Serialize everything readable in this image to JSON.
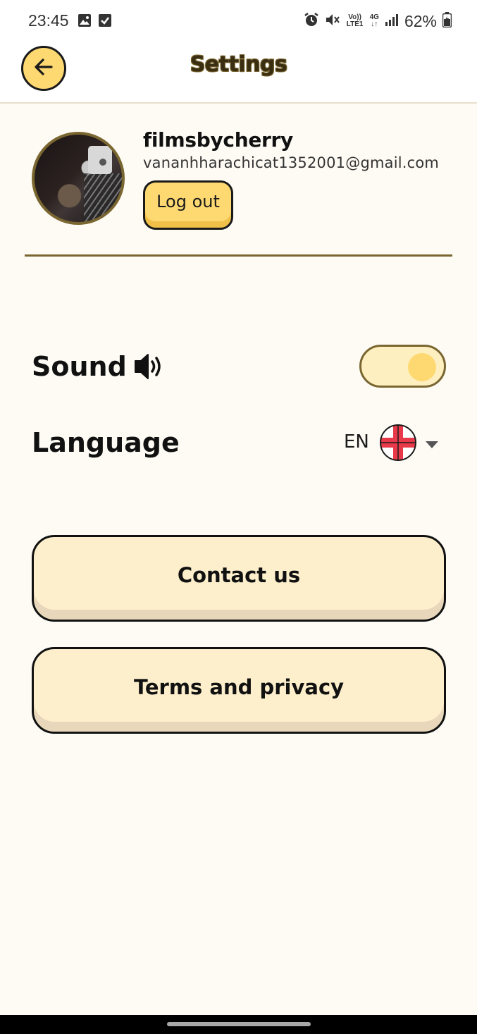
{
  "status_bar": {
    "time": "23:45",
    "battery": "62%",
    "network_volte": "Vo)) LTE1",
    "network_type": "4G",
    "icons": [
      "gallery-icon",
      "checkbox-icon",
      "alarm-icon",
      "mute-icon",
      "signal-icon",
      "battery-icon"
    ]
  },
  "header": {
    "title": "Settings",
    "back_icon": "arrow-left-icon"
  },
  "profile": {
    "username": "filmsbycherry",
    "email": "vananhharachicat1352001@gmail.com",
    "logout_label": "Log out"
  },
  "settings": {
    "sound_label": "Sound",
    "sound_icon": "speaker-icon",
    "sound_enabled": true,
    "language_label": "Language",
    "language_code": "EN",
    "language_flag": "england-flag-icon"
  },
  "buttons": {
    "contact_label": "Contact us",
    "terms_label": "Terms and privacy"
  },
  "colors": {
    "accent": "#fed972",
    "button_fill": "#fdefcc",
    "border_brown": "#7a6630",
    "background": "#fdfbf4"
  }
}
